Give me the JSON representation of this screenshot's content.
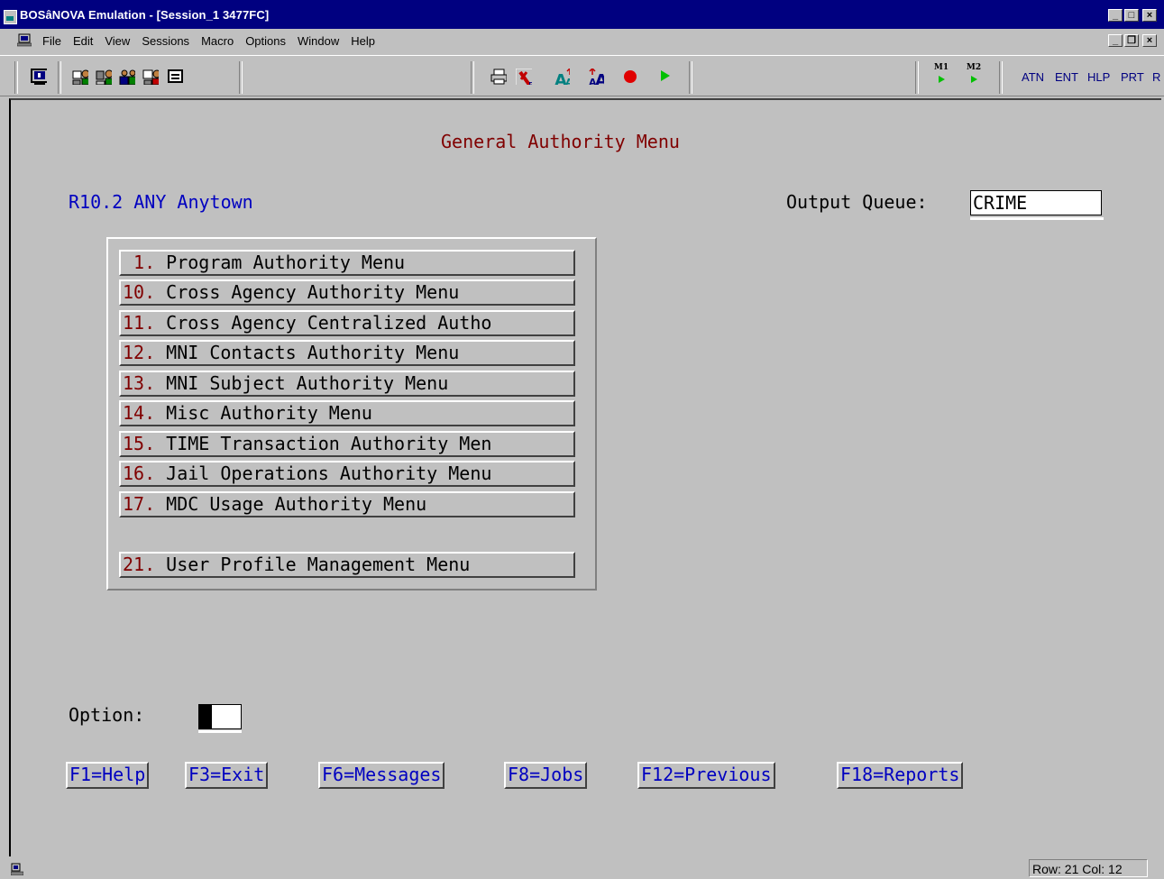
{
  "window": {
    "title": "BOSâNOVA Emulation - [Session_1 3477FC]",
    "controls": [
      "_",
      "□",
      "×"
    ]
  },
  "menubar": {
    "items": [
      "File",
      "Edit",
      "View",
      "Sessions",
      "Macro",
      "Options",
      "Window",
      "Help"
    ],
    "mdi_controls": [
      "_",
      "❐",
      "×"
    ]
  },
  "toolbar": {
    "macro_labels": [
      "M1",
      "M2"
    ],
    "text_buttons": [
      "ATN",
      "ENT",
      "HLP",
      "PRT",
      "R"
    ]
  },
  "screen": {
    "heading": "General Authority Menu",
    "system": "R10.2 ANY Anytown",
    "output_queue_label": "Output Queue:",
    "output_queue_value": "CRIME",
    "menu_items": [
      {
        "num": " 1.",
        "label": "Program Authority Menu"
      },
      {
        "num": "10.",
        "label": "Cross Agency Authority Menu"
      },
      {
        "num": "11.",
        "label": "Cross Agency Centralized Autho"
      },
      {
        "num": "12.",
        "label": "MNI Contacts Authority Menu"
      },
      {
        "num": "13.",
        "label": "MNI Subject Authority Menu"
      },
      {
        "num": "14.",
        "label": "Misc Authority Menu"
      },
      {
        "num": "15.",
        "label": "TIME Transaction Authority Men"
      },
      {
        "num": "16.",
        "label": "Jail Operations Authority Menu"
      },
      {
        "num": "17.",
        "label": "MDC Usage Authority Menu"
      },
      {
        "num": "21.",
        "label": "User Profile Management Menu"
      }
    ],
    "option_label": "Option:",
    "function_keys": [
      "F1=Help",
      "F3=Exit",
      "F6=Messages",
      "F8=Jobs",
      "F12=Previous",
      "F18=Reports"
    ]
  },
  "statusbar": {
    "position": "Row: 21  Col: 12"
  },
  "colors": {
    "title_bg": "#000080",
    "field_label": "#0000c0",
    "menu_number": "#800000"
  }
}
